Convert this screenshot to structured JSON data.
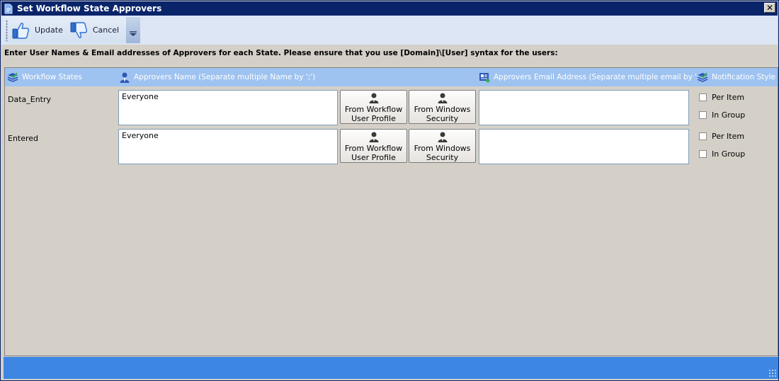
{
  "window": {
    "title": "Set Workflow State Approvers",
    "close_label": "✕"
  },
  "toolbar": {
    "update_label": "Update",
    "cancel_label": "Cancel"
  },
  "instructions": "Enter User Names & Email addresses of Approvers for each State.  Please ensure that you use [Domain]\\[User] syntax for the users:",
  "grid": {
    "headers": {
      "states": "Workflow States",
      "names": "Approvers Name (Separate multiple Name by ';')",
      "emails": "Approvers Email Address (Separate multiple email by ';')",
      "notification": "Notification Style"
    },
    "buttons": {
      "workflow_line1": "From Workflow",
      "workflow_line2": "User Profile",
      "windows_line1": "From Windows",
      "windows_line2": "Security"
    },
    "options": {
      "per_item": "Per Item",
      "in_group": "In Group"
    },
    "rows": [
      {
        "state": "Data_Entry",
        "approvers": "Everyone",
        "email": "",
        "per_item": false,
        "in_group": false
      },
      {
        "state": "Entered",
        "approvers": "Everyone",
        "email": "",
        "per_item": false,
        "in_group": false
      }
    ]
  },
  "colors": {
    "titlebar": "#0a246a",
    "header": "#9fc3f0",
    "statusbar": "#3d86e2"
  }
}
